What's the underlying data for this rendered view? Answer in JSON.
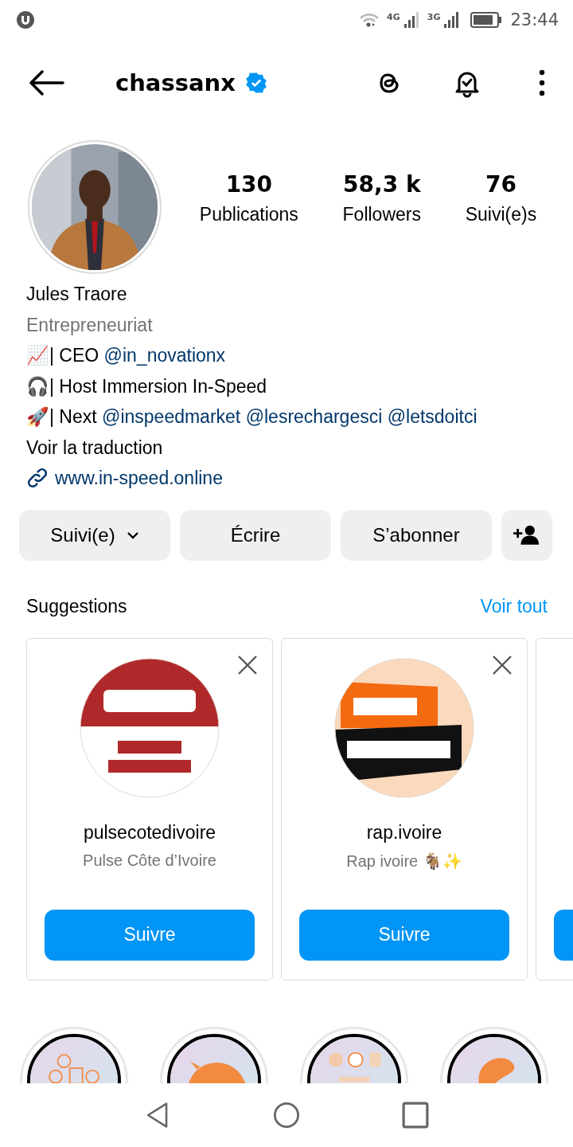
{
  "status_bar": {
    "networks": [
      "4G",
      "3G"
    ],
    "time": "23:44"
  },
  "header": {
    "username": "chassanx",
    "verified": true
  },
  "profile": {
    "stats": [
      {
        "value": "130",
        "label": "Publications"
      },
      {
        "value": "58,3 k",
        "label": "Followers"
      },
      {
        "value": "76",
        "label": "Suivi(e)s"
      }
    ],
    "name": "Jules Traore",
    "category": "Entrepreneuriat",
    "bio": [
      {
        "text": "📈| CEO",
        "links": [
          "@in_novationx"
        ]
      },
      {
        "text": "🎧| Host Immersion In-Speed"
      },
      {
        "text": "🚀| Next",
        "links": [
          "@inspeedmarket",
          "@lesrechargesci",
          "@letsdoitci"
        ]
      }
    ],
    "translate": "Voir la traduction",
    "website": "www.in-speed.online"
  },
  "actions": [
    {
      "kind": "dropdown",
      "label": "Suivi(e)"
    },
    {
      "kind": "plain",
      "label": "Écrire"
    },
    {
      "kind": "plain",
      "label": "S’abonner"
    },
    {
      "kind": "add-person"
    }
  ],
  "suggestions": {
    "title": "Suggestions",
    "see_all": "Voir tout",
    "more_cut_off": true,
    "cards": [
      {
        "username": "pulsecotedivoire",
        "subtitle": "Pulse Côte d’Ivoire",
        "button": "Suivre"
      },
      {
        "username": "rap.ivoire",
        "subtitle": "Rap ivoire 🐐✨",
        "button": "Suivre"
      }
    ]
  }
}
